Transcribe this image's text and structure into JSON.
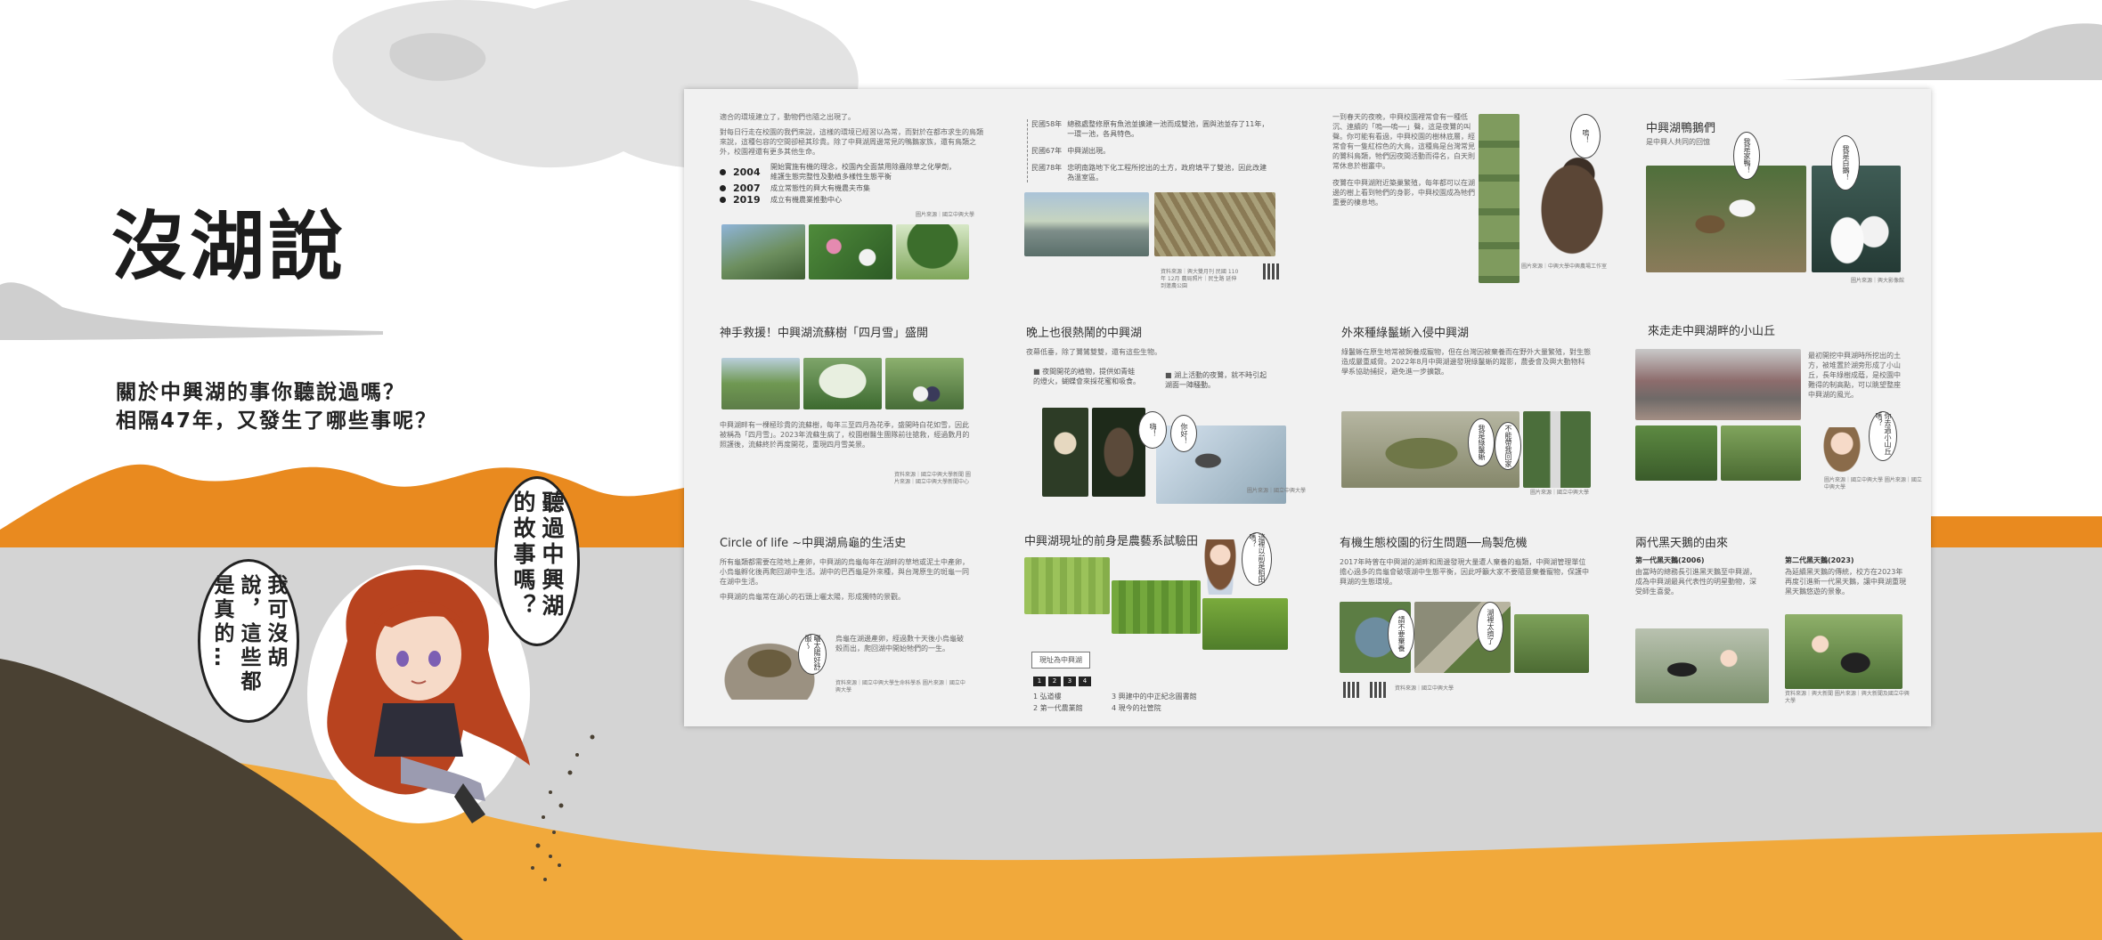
{
  "title": "沒湖說",
  "subtitle_lines": [
    "關於中興湖的事你聽說過嗎？",
    "相隔47年，又發生了哪些事呢？"
  ],
  "bubbles": {
    "right": "聽過中興湖的故事嗎？",
    "left": "我可沒胡說，這些都是真的…"
  },
  "colors": {
    "orange": "#e98a1f",
    "light_orange": "#f1a93b",
    "gray": "#d3d3d3",
    "dark_brown": "#4a4133"
  },
  "board": {
    "p1": {
      "intro": "適合的環境建立了，動物們也隨之出現了。",
      "para": "對每日行走在校園的我們來說，這樣的環境已經習以為常，而對於在都市求生的鳥類來說，這種包容的空間卻極其珍貴。除了中興湖周邊常見的鴨鵝家族，還有鳥類之外，校園裡還有更多其他生命。",
      "timeline": [
        {
          "year": "2004",
          "text": "開始實施有機的理念，校園內全面禁用除蟲除草之化學劑，維護生態完整性及動植多樣性生態平衡"
        },
        {
          "year": "2007",
          "text": "成立常態性的興大有機農夫市集"
        },
        {
          "year": "2019",
          "text": "成立有機農業推動中心"
        }
      ],
      "caption": "圖片來源｜國立中興大學"
    },
    "p2": {
      "rows": [
        {
          "year": "民國58年",
          "text": "總務處整修原有魚池並擴建一池而成雙池，圓與池並存了11年，一環一池，各具特色。"
        },
        {
          "year": "民國67年",
          "text": "中興湖出現。"
        },
        {
          "year": "民國78年",
          "text": "忠明南路地下化工程所挖出的土方，政府填平了雙池，因此改建為溫室區。"
        }
      ],
      "caption": "資料來源｜興大雙月刊 民國 110年 12月 農局照片｜民生路 延伸到蓮農公園"
    },
    "p3": {
      "para1": "一到春天的夜晚，中興校園裡常會有一種低沉、連續的「嗚──嗚──」聲，這是夜鷺的叫聲。你可能有看過，中興校園的樹林底層，經常會有一隻紅棕色的大鳥，這種鳥是台灣常見的鷺科鳥類，牠們因夜間活動而得名，白天則常休息於樹叢中。",
      "para2": "夜鷺在中興湖附近築巢繁殖，每年都可以在湖邊的樹上看到牠們的身影，中興校園成為牠們重要的棲息地。",
      "bubble": "嗚！",
      "caption": "圖片來源｜中興大學中興農場工作室"
    },
    "p4": {
      "title": "中興湖鴨鵝們",
      "subtitle": "是中興人共同的回憶",
      "bubbles": [
        "我是家鴨！",
        "我是白鵝！"
      ],
      "caption": "圖片來源｜興大影像館"
    },
    "p5": {
      "title": "神手救援！中興湖流蘇樹「四月雪」盛開",
      "para": "中興湖畔有一棵極珍貴的流蘇樹，每年三至四月為花季，盛開時白花如雪，因此被稱為「四月雪」。2023年流蘇生病了，校園樹醫生團隊前往搶救，經過數月的照護後，流蘇終於再度開花，重現四月雪美景。",
      "caption": "資料來源｜國立中興大學新聞 圖片來源｜國立中興大學新聞中心"
    },
    "p6": {
      "title": "晚上也很熱鬧的中興湖",
      "intro": "夜幕低垂，除了鷺鷥雙雙，還有這些生物。",
      "list_a": "■ 夜間開花的植物，提供如青蛙的燈火，蝴蝶會來採花蜜和吸食。",
      "list_b": "■ 湖上活動的夜鷺，就不時引起湖面一陣騷動。",
      "bubbles": [
        "嗨！",
        "你好！"
      ],
      "caption": "圖片來源｜國立中興大學"
    },
    "p7": {
      "title": "外來種綠鬣蜥入侵中興湖",
      "para": "綠鬣蜥在原生地常被飼養成寵物，但在台灣因被棄養而在野外大量繁殖，對生態造成嚴重威脅。2022年8月中興湖邊發現綠鬣蜥的蹤影，農委會及興大動物科學系協助捕捉，避免進一步擴散。",
      "bubbles": [
        "我是綠鬣蜥",
        "不能帶我回家"
      ],
      "caption": "圖片來源｜國立中興大學"
    },
    "p8": {
      "title": "來走走中興湖畔的小山丘",
      "para": "最初開挖中興湖時所挖出的土方，被堆置於湖旁形成了小山丘，長年綠樹成蔭，是校園中難得的制高點，可以眺望整座中興湖的風光。",
      "bubble": "你去過小山丘嗎？",
      "caption": "圖片來源｜國立中興大學 圖片來源｜國立中興大學"
    },
    "p9": {
      "title": "Circle of life ~中興湖烏龜的生活史",
      "para1": "所有龜類都需要在陸地上產卵，中興湖的烏龜每年在湖畔的草地或泥土中產卵，小烏龜孵化後再爬回湖中生活。湖中的巴西龜是外來種，與台灣原生的斑龜一同在湖中生活。",
      "para2": "中興湖的烏龜常在湖心的石頭上曬太陽，形成獨特的景觀。",
      "bubble": "曬太陽好舒服～",
      "para3": "烏龜在湖邊產卵，經過數十天後小烏龜破殼而出，爬回湖中開始牠們的一生。",
      "caption": "資料來源｜國立中興大學生命科學系 圖片來源｜國立中興大學"
    },
    "p10": {
      "title": "中興湖現址的前身是農藝系試驗田",
      "button": "現址為中興湖",
      "bubble": "這裡以前是稻田嗎？",
      "legend": [
        {
          "num": "1",
          "text": "弘道樓"
        },
        {
          "num": "2",
          "text": "第一代農業館"
        },
        {
          "num": "3",
          "text": "興建中的中正紀念圖書館"
        },
        {
          "num": "4",
          "text": "現今的社管院"
        }
      ]
    },
    "p11": {
      "title": "有機生態校園的衍生問題──烏製危機",
      "para": "2017年時曾在中興湖的湖畔和周邊發現大量遭人棄養的龜類，中興湖管理單位擔心過多的烏龜會破壞湖中生態平衡，因此呼籲大家不要隨意棄養寵物，保護中興湖的生態環境。",
      "bubbles": [
        "請不要棄養",
        "湖裡太擠了"
      ],
      "caption": "資料來源｜國立中興大學"
    },
    "p12": {
      "title": "兩代黑天鵝的由來",
      "gen1_title": "第一代黑天鵝(2006)",
      "gen1_text": "由當時的總務長引進黑天鵝至中興湖，成為中興湖最具代表性的明星動物，深受師生喜愛。",
      "gen2_title": "第二代黑天鵝(2023)",
      "gen2_text": "為延續黑天鵝的傳統，校方在2023年再度引進新一代黑天鵝，讓中興湖重現黑天鵝悠遊的景象。",
      "caption": "資料來源｜興大新聞 圖片來源｜興大新聞及國立中興大學"
    }
  }
}
